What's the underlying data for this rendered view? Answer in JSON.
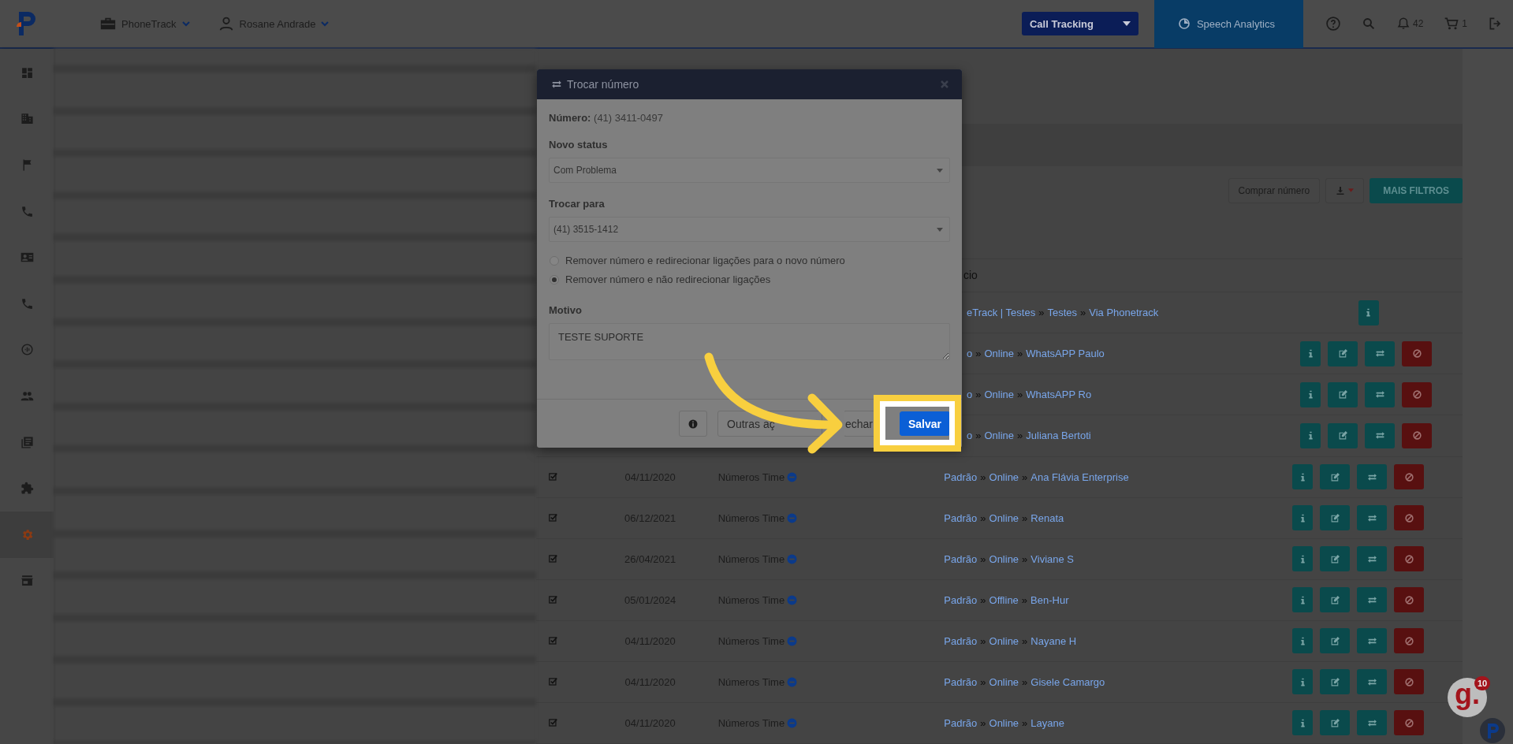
{
  "topbar": {
    "menus": [
      {
        "label": "PhoneTrack"
      },
      {
        "label": "Rosane Andrade"
      }
    ],
    "product_select": "Call Tracking",
    "speech_analytics": "Speech Analytics",
    "notifications": "42",
    "cart": "1"
  },
  "sidebar": {
    "items": [
      {
        "kind": "dashboard",
        "selected": false
      },
      {
        "kind": "building",
        "selected": false
      },
      {
        "kind": "flag",
        "selected": false
      },
      {
        "kind": "phone",
        "selected": false
      },
      {
        "kind": "contact",
        "selected": false
      },
      {
        "kind": "phone",
        "selected": false
      },
      {
        "kind": "wave",
        "selected": false
      },
      {
        "kind": "users",
        "selected": false
      },
      {
        "kind": "documents",
        "selected": false
      },
      {
        "kind": "puzzle",
        "selected": false
      },
      {
        "kind": "gear",
        "selected": true
      },
      {
        "kind": "store",
        "selected": false
      }
    ]
  },
  "toolbar": {
    "buttons": [
      {
        "kind": "outline",
        "label": "Comprar número"
      },
      {
        "kind": "download"
      },
      {
        "kind": "primary",
        "label": "MAIS FILTROS"
      }
    ]
  },
  "table": {
    "header_fragment": "cio",
    "separator": "»",
    "rows": [
      {
        "kind": "covered",
        "path": [
          "eTrack | Testes",
          "Testes",
          "Via Phonetrack"
        ],
        "actions": [
          {
            "kind": "info"
          }
        ]
      },
      {
        "kind": "covered",
        "path": [
          "o",
          "Online",
          "WhatsAPP Paulo"
        ],
        "actions": [
          {
            "kind": "info"
          },
          {
            "kind": "edit"
          },
          {
            "kind": "swap"
          },
          {
            "kind": "block"
          }
        ]
      },
      {
        "kind": "covered",
        "path": [
          "o",
          "Online",
          "WhatsAPP Ro"
        ],
        "actions": [
          {
            "kind": "info"
          },
          {
            "kind": "edit"
          },
          {
            "kind": "swap"
          },
          {
            "kind": "block"
          }
        ]
      },
      {
        "kind": "covered",
        "path": [
          "o",
          "Online",
          "Juliana Bertoti"
        ],
        "actions": [
          {
            "kind": "info"
          },
          {
            "kind": "edit"
          },
          {
            "kind": "swap"
          },
          {
            "kind": "block"
          }
        ]
      },
      {
        "kind": "full",
        "checked": true,
        "date": "04/11/2020",
        "status": "Números Time",
        "path": [
          "Padrão",
          "Online",
          "Ana Flávia Enterprise"
        ],
        "actions": [
          {
            "kind": "info"
          },
          {
            "kind": "edit"
          },
          {
            "kind": "swap"
          },
          {
            "kind": "block"
          }
        ]
      },
      {
        "kind": "full",
        "checked": true,
        "date": "06/12/2021",
        "status": "Números Time",
        "path": [
          "Padrão",
          "Online",
          "Renata"
        ],
        "actions": [
          {
            "kind": "info"
          },
          {
            "kind": "edit"
          },
          {
            "kind": "swap"
          },
          {
            "kind": "block"
          }
        ]
      },
      {
        "kind": "full",
        "checked": true,
        "date": "26/04/2021",
        "status": "Números Time",
        "path": [
          "Padrão",
          "Online",
          "Viviane S"
        ],
        "actions": [
          {
            "kind": "info"
          },
          {
            "kind": "edit"
          },
          {
            "kind": "swap"
          },
          {
            "kind": "block"
          }
        ]
      },
      {
        "kind": "full",
        "checked": true,
        "date": "05/01/2024",
        "status": "Números Time",
        "path": [
          "Padrão",
          "Offline",
          "Ben-Hur"
        ],
        "actions": [
          {
            "kind": "info"
          },
          {
            "kind": "edit"
          },
          {
            "kind": "swap"
          },
          {
            "kind": "block"
          }
        ]
      },
      {
        "kind": "full",
        "checked": true,
        "date": "04/11/2020",
        "status": "Números Time",
        "path": [
          "Padrão",
          "Online",
          "Nayane H"
        ],
        "actions": [
          {
            "kind": "info"
          },
          {
            "kind": "edit"
          },
          {
            "kind": "swap"
          },
          {
            "kind": "block"
          }
        ]
      },
      {
        "kind": "full",
        "checked": true,
        "date": "04/11/2020",
        "status": "Números Time",
        "path": [
          "Padrão",
          "Online",
          "Gisele Camargo"
        ],
        "actions": [
          {
            "kind": "info"
          },
          {
            "kind": "edit"
          },
          {
            "kind": "swap"
          },
          {
            "kind": "block"
          }
        ]
      },
      {
        "kind": "full",
        "checked": true,
        "date": "04/11/2020",
        "status": "Números Time",
        "path": [
          "Padrão",
          "Online",
          "Layane"
        ],
        "actions": [
          {
            "kind": "info"
          },
          {
            "kind": "edit"
          },
          {
            "kind": "swap"
          },
          {
            "kind": "block"
          }
        ]
      }
    ]
  },
  "dialog": {
    "title": "Trocar número",
    "number_label": "Número:",
    "number": "(41) 3411-0497",
    "status_label": "Novo status",
    "status_value": "Com Problema",
    "target_label": "Trocar para",
    "target_value": "(41) 3515-1412",
    "options": [
      {
        "label": "Remover número e redirecionar ligações para o novo número",
        "selected": false
      },
      {
        "label": "Remover número e não redirecionar ligações",
        "selected": true
      }
    ],
    "reason_label": "Motivo",
    "reason_value": "TESTE SUPORTE",
    "buttons": [
      {
        "kind": "info"
      },
      {
        "kind": "default",
        "label": "Outras aç"
      },
      {
        "kind": "close",
        "label": "echar"
      },
      {
        "kind": "primary",
        "label": "Salvar"
      }
    ]
  },
  "floating_badge": {
    "label": "g.",
    "count": "10"
  }
}
